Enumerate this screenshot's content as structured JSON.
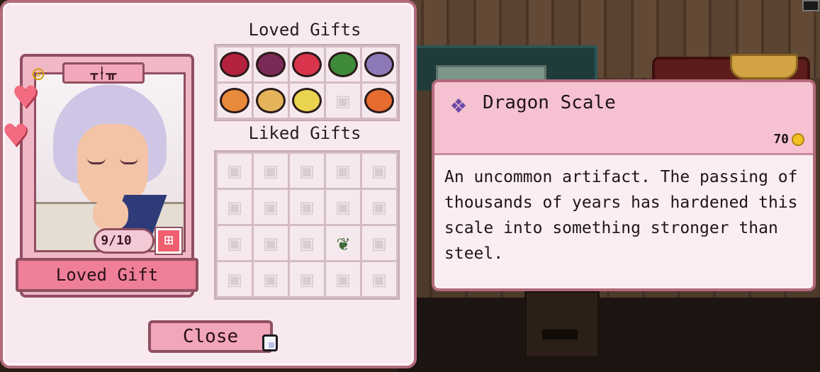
{
  "gift_panel": {
    "character_name": "ᚁᛂᚂ",
    "hearts_count": 2,
    "gift_count": "9/10",
    "status_label": "Loved Gift",
    "loved_title": "Loved Gifts",
    "liked_title": "Liked Gifts",
    "close_label": "Close",
    "loved_gifts": [
      {
        "name": "beet",
        "color": "#b4213e"
      },
      {
        "name": "purple-dish",
        "color": "#7b2a55"
      },
      {
        "name": "red-soup",
        "color": "#d8344b"
      },
      {
        "name": "green-soup",
        "color": "#3e8a3a"
      },
      {
        "name": "dragon-scale",
        "color": "#8d79b8"
      },
      {
        "name": "orange-dish",
        "color": "#e9893a"
      },
      {
        "name": "noodle-dish",
        "color": "#e4b35a"
      },
      {
        "name": "egg-dish",
        "color": "#e9d34f"
      },
      {
        "name": "locked",
        "color": ""
      },
      {
        "name": "tomato-soup",
        "color": "#e56b2f"
      }
    ],
    "liked_gifts": [
      "locked",
      "locked",
      "locked",
      "locked",
      "locked",
      "locked",
      "locked",
      "locked",
      "locked",
      "locked",
      "locked",
      "locked",
      "locked",
      "herb-sprig",
      "locked",
      "locked",
      "locked",
      "locked",
      "locked",
      "locked"
    ]
  },
  "tooltip": {
    "item_name": "Dragon Scale",
    "price": "70",
    "icon": "dragon-scale-icon",
    "description": "An uncommon artifact. The passing of thousands of years has hardened this scale into something stronger than steel."
  },
  "colors": {
    "panel_bg": "#f8e9ef",
    "panel_border": "#b26a7c",
    "accent_pink": "#ef7f98",
    "coin": "#f1c022"
  }
}
